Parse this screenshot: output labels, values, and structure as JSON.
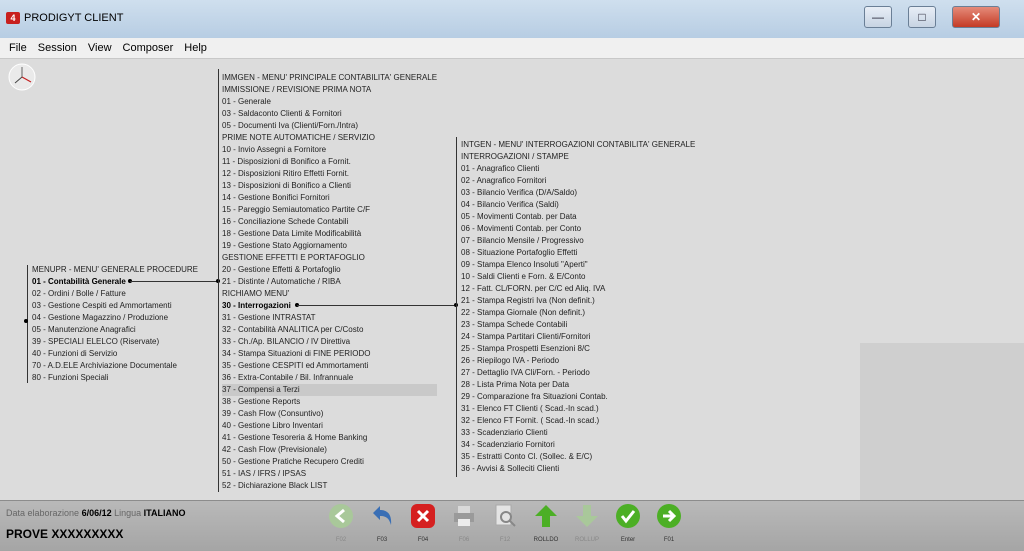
{
  "window": {
    "app_icon": "app-logo-icon",
    "title": "PRODIGYT CLIENT",
    "buttons": [
      "minimize-icon",
      "maximize-icon",
      "close-icon"
    ]
  },
  "menubar": [
    "File",
    "Session",
    "View",
    "Composer",
    "Help"
  ],
  "menupr": {
    "title": "MENUPR - MENU' GENERALE PROCEDURE",
    "items": [
      "01 - Contabilità Generale",
      "02 - Ordini / Bolle / Fatture",
      "03 - Gestione Cespiti ed Ammortamenti",
      "04 - Gestione Magazzino / Produzione",
      "05 - Manutenzione Anagrafici",
      "39 - SPECIALI ELELCO (Riservate)",
      "40 - Funzioni di Servizio",
      "70 - A.D.ELE Archiviazione Documentale",
      "80 - Funzioni Speciali"
    ]
  },
  "immgen": {
    "lines": [
      "IMMGEN - MENU' PRINCIPALE CONTABILITA' GENERALE",
      "IMMISSIONE / REVISIONE PRIMA NOTA",
      "01 - Generale",
      "03 - Saldaconto Clienti & Fornitori",
      "05 - Documenti Iva (Clienti/Forn./Intra)",
      "PRIME NOTE AUTOMATICHE / SERVIZIO",
      "10 - Invio Assegni a Fornitore",
      "11 - Disposizioni di Bonifico a Fornit.",
      "12 - Disposizioni Ritiro Effetti Fornit.",
      "13 - Disposizioni di Bonifico a Clienti",
      "14 - Gestione Bonifici Fornitori",
      "15 - Pareggio Semiautomatico Partite C/F",
      "16 - Conciliazione Schede Contabili",
      "18 - Gestione Data Limite Modificabilità",
      "19 - Gestione Stato Aggiornamento",
      "GESTIONE EFFETTI E PORTAFOGLIO",
      "20 - Gestione Effetti & Portafoglio",
      "21 - Distinte / Automatiche / RIBA",
      "RICHIAMO MENU'",
      "30 - Interrogazioni",
      "31 - Gestione INTRASTAT",
      "32 - Contabilità ANALITICA per C/Costo",
      "33 - Ch./Ap. BILANCIO / IV Direttiva",
      "34 - Stampa Situazioni di FINE PERIODO",
      "35 - Gestione CESPITI ed Ammortamenti",
      "36 - Extra-Contabile / Bil. Infrannuale",
      "37 - Compensi a Terzi",
      "38 - Gestione Reports",
      "39 - Cash Flow (Consuntivo)",
      "40 - Gestione Libro Inventari",
      "41 - Gestione Tesoreria & Home Banking",
      "42 - Cash Flow (Previsionale)",
      "50 - Gestione Pratiche Recupero Crediti",
      "51 - IAS / IFRS / IPSAS",
      "52 - Dichiarazione Black LIST"
    ]
  },
  "intgen": {
    "lines": [
      "INTGEN - MENU' INTERROGAZIONI CONTABILITA' GENERALE",
      "INTERROGAZIONI / STAMPE",
      "01 - Anagrafico Clienti",
      "02 - Anagrafico Fornitori",
      "03 - Bilancio Verifica (D/A/Saldo)",
      "04 - Bilancio Verifica (Saldi)",
      "05 - Movimenti Contab. per Data",
      "06 - Movimenti Contab. per Conto",
      "07 - Bilancio Mensile / Progressivo",
      "08 - Situazione Portafoglio Effetti",
      "09 - Stampa Elenco Insoluti \"Aperti\"",
      "10 - Saldi Clienti e Forn. & E/Conto",
      "12 - Fatt. CL/FORN. per C/C ed Aliq. IVA",
      "21 - Stampa Registri Iva (Non definit.)",
      "22 - Stampa Giornale      (Non definit.)",
      "23 - Stampa Schede Contabili",
      "24 - Stampa Partitari Clienti/Fornitori",
      "25 - Stampa Prospetti Esenzioni 8/C",
      "26 - Riepilogo IVA          - Periodo",
      "27 - Dettaglio IVA Cli/Forn. - Periodo",
      "28 - Lista Prima Nota per Data",
      "29 - Comparazione fra Situazioni Contab.",
      "31 - Elenco FT Clienti ( Scad.-In scad.)",
      "32 - Elenco FT Fornit. ( Scad.-In scad.)",
      "33 - Scadenziario Clienti",
      "34 - Scadenziario Fornitori",
      "35 - Estratti Conto Cl. (Sollec. & E/C)",
      "36 - Avvisi & Solleciti Clienti"
    ]
  },
  "status": {
    "date_label": "Data elaborazione",
    "date_value": "6/06/12",
    "lang_label": "Lingua",
    "lang_value": "ITALIANO",
    "company": "PROVE XXXXXXXXX"
  },
  "fkeys": [
    {
      "icon": "back-arrow-icon",
      "label": "F02",
      "enabled": false
    },
    {
      "icon": "undo-arrow-icon",
      "label": "F03",
      "enabled": true
    },
    {
      "icon": "cancel-x-icon",
      "label": "F04",
      "enabled": true
    },
    {
      "icon": "printer-icon",
      "label": "F06",
      "enabled": false
    },
    {
      "icon": "magnifier-icon",
      "label": "F12",
      "enabled": false
    },
    {
      "icon": "arrow-up-icon",
      "label": "ROLLDO",
      "enabled": true
    },
    {
      "icon": "arrow-down-icon",
      "label": "ROLLUP",
      "enabled": false
    },
    {
      "icon": "checkmark-icon",
      "label": "Enter",
      "enabled": true
    },
    {
      "icon": "forward-arrow-icon",
      "label": "F01",
      "enabled": true
    }
  ],
  "colors": {
    "green": "#4caf25",
    "blue": "#3a6fb5",
    "red": "#d52020",
    "gray": "#9a9a9a"
  }
}
